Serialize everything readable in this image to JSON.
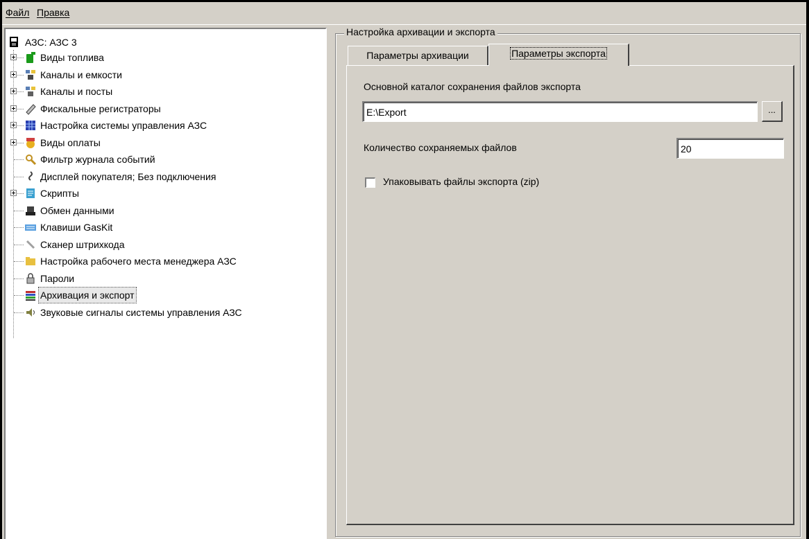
{
  "menu": {
    "file": "Файл",
    "edit": "Правка"
  },
  "tree": {
    "root": "АЗС: АЗС 3",
    "items": [
      {
        "label": "Виды топлива",
        "expandable": true,
        "icon": "fuel-can-icon"
      },
      {
        "label": "Каналы и емкости",
        "expandable": true,
        "icon": "tanks-icon"
      },
      {
        "label": "Каналы и посты",
        "expandable": true,
        "icon": "pumps-icon"
      },
      {
        "label": "Фискальные регистраторы",
        "expandable": true,
        "icon": "fiscal-printer-icon"
      },
      {
        "label": "Настройка системы управления АЗС",
        "expandable": true,
        "icon": "grid-settings-icon"
      },
      {
        "label": "Виды оплаты",
        "expandable": true,
        "icon": "payment-icon"
      },
      {
        "label": "Фильтр журнала событий",
        "expandable": false,
        "icon": "magnifier-icon"
      },
      {
        "label": "Дисплей покупателя; Без подключения",
        "expandable": false,
        "icon": "customer-display-icon"
      },
      {
        "label": "Скрипты",
        "expandable": true,
        "icon": "scripts-icon"
      },
      {
        "label": "Обмен данными",
        "expandable": false,
        "icon": "data-exchange-icon"
      },
      {
        "label": "Клавиши GasKit",
        "expandable": false,
        "icon": "keyboard-icon"
      },
      {
        "label": "Сканер штрихкода",
        "expandable": false,
        "icon": "barcode-scanner-icon"
      },
      {
        "label": "Настройка рабочего места менеджера АЗС",
        "expandable": false,
        "icon": "folder-icon"
      },
      {
        "label": "Пароли",
        "expandable": false,
        "icon": "lock-icon"
      },
      {
        "label": "Архивация и экспорт",
        "expandable": false,
        "icon": "archive-books-icon",
        "selected": true
      },
      {
        "label": "Звуковые сигналы системы управления АЗС",
        "expandable": false,
        "icon": "speaker-icon"
      }
    ]
  },
  "panel": {
    "group_title": "Настройка архивации и экспорта",
    "tabs": [
      {
        "label": "Параметры архивации",
        "active": false
      },
      {
        "label": "Параметры экспорта",
        "active": true
      }
    ],
    "export_dir_label": "Основной каталог сохранения файлов экспорта",
    "export_dir_value": "E:\\Export",
    "browse_label": "...",
    "files_count_label": "Количество сохраняемых файлов",
    "files_count_value": "20",
    "zip_label": "Упаковывать файлы экспорта (zip)",
    "zip_checked": false
  }
}
